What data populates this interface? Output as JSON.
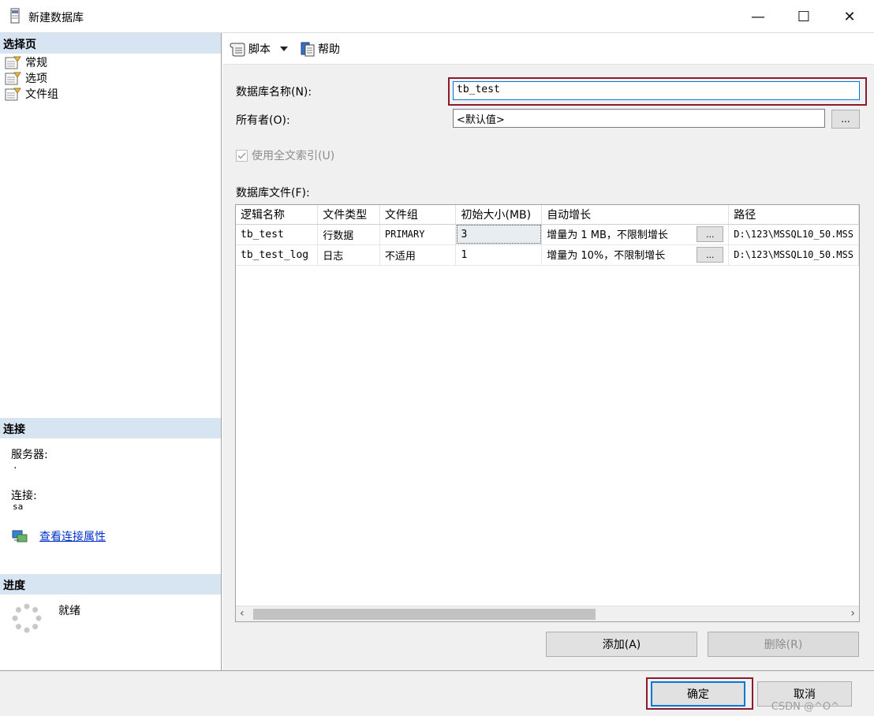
{
  "window": {
    "title": "新建数据库",
    "minimize_glyph": "—",
    "maximize_glyph": "☐",
    "close_glyph": "✕"
  },
  "sidebar": {
    "select_page_header": "选择页",
    "pages": [
      {
        "label": "常规",
        "icon": "page-icon"
      },
      {
        "label": "选项",
        "icon": "page-icon"
      },
      {
        "label": "文件组",
        "icon": "page-icon"
      }
    ],
    "connection_header": "连接",
    "server_label": "服务器:",
    "server_value": ".",
    "connection_label": "连接:",
    "connection_value": "sa",
    "view_connection_link": "查看连接属性",
    "progress_header": "进度",
    "progress_status": "就绪"
  },
  "toolbar": {
    "script_label": "脚本",
    "help_label": "帮助"
  },
  "form": {
    "db_name_label": "数据库名称(N):",
    "db_name_value": "tb_test",
    "owner_label": "所有者(O):",
    "owner_value": "<默认值>",
    "ellipsis": "...",
    "fulltext_label": "使用全文索引(U)",
    "fulltext_checked": true,
    "files_label": "数据库文件(F):"
  },
  "grid": {
    "columns": [
      "逻辑名称",
      "文件类型",
      "文件组",
      "初始大小(MB)",
      "自动增长",
      "路径"
    ],
    "rows": [
      {
        "logical_name": "tb_test",
        "file_type": "行数据",
        "filegroup": "PRIMARY",
        "initial_size": "3",
        "autogrowth": "增量为 1 MB，不限制增长",
        "path": "D:\\123\\MSSQL10_50.MSS"
      },
      {
        "logical_name": "tb_test_log",
        "file_type": "日志",
        "filegroup": "不适用",
        "initial_size": "1",
        "autogrowth": "增量为 10%，不限制增长",
        "path": "D:\\123\\MSSQL10_50.MSS"
      }
    ],
    "cell_button": "..."
  },
  "buttons": {
    "add": "添加(A)",
    "remove": "删除(R)",
    "ok": "确定",
    "cancel": "取消"
  },
  "watermark": "CSDN @^O^",
  "colors": {
    "header_bg": "#d7e4f2",
    "highlight": "#8b1a2c",
    "focus": "#0078d7",
    "link": "#0033cc"
  }
}
